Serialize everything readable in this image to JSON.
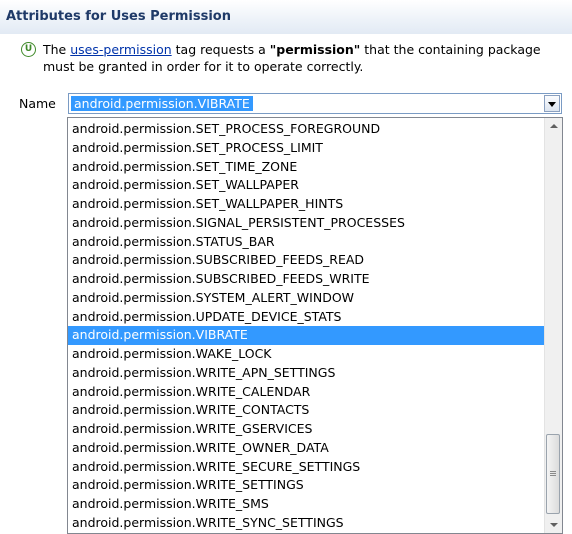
{
  "section": {
    "title": "Attributes for Uses Permission"
  },
  "description": {
    "icon": "info-circle-icon",
    "icon_glyph": "U",
    "prefix": "The ",
    "link": "uses-permission",
    "middle": " tag requests a ",
    "bold": "\"permission\"",
    "suffix": " that the containing package must be granted in order for it to operate correctly."
  },
  "name_field": {
    "label": "Name",
    "value": "android.permission.VIBRATE",
    "dropdown_icon": "chevron-down-icon"
  },
  "dropdown": {
    "selected": "android.permission.VIBRATE",
    "items": [
      "android.permission.SET_PROCESS_FOREGROUND",
      "android.permission.SET_PROCESS_LIMIT",
      "android.permission.SET_TIME_ZONE",
      "android.permission.SET_WALLPAPER",
      "android.permission.SET_WALLPAPER_HINTS",
      "android.permission.SIGNAL_PERSISTENT_PROCESSES",
      "android.permission.STATUS_BAR",
      "android.permission.SUBSCRIBED_FEEDS_READ",
      "android.permission.SUBSCRIBED_FEEDS_WRITE",
      "android.permission.SYSTEM_ALERT_WINDOW",
      "android.permission.UPDATE_DEVICE_STATS",
      "android.permission.VIBRATE",
      "android.permission.WAKE_LOCK",
      "android.permission.WRITE_APN_SETTINGS",
      "android.permission.WRITE_CALENDAR",
      "android.permission.WRITE_CONTACTS",
      "android.permission.WRITE_GSERVICES",
      "android.permission.WRITE_OWNER_DATA",
      "android.permission.WRITE_SECURE_SETTINGS",
      "android.permission.WRITE_SETTINGS",
      "android.permission.WRITE_SMS",
      "android.permission.WRITE_SYNC_SETTINGS"
    ]
  },
  "colors": {
    "header_text": "#1f3a68",
    "link": "#0033aa",
    "selection": "#3399ff",
    "info_icon": "#3f8a2a"
  }
}
